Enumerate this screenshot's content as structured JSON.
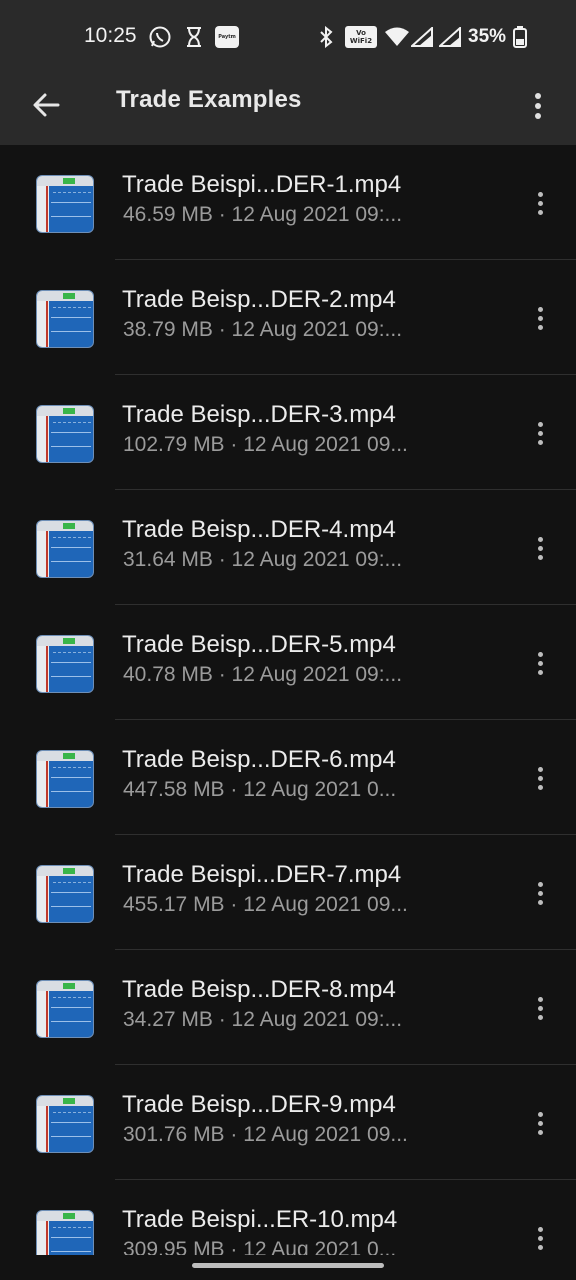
{
  "status_bar": {
    "time": "10:25",
    "icons_left": [
      "whatsapp-icon",
      "hourglass-icon",
      "paytm-icon"
    ],
    "icons_right": [
      "bluetooth-icon",
      "vowifi-icon",
      "wifi-icon",
      "signal-icon",
      "signal-icon",
      "battery-icon"
    ],
    "paytm_label": "Paytm",
    "vowifi_label": "Vo WiFi2",
    "battery": "35%"
  },
  "app_bar": {
    "title": "Trade Examples"
  },
  "files": [
    {
      "name": "Trade Beispi...DER-1.mp4",
      "meta": "46.59 MB · 12 Aug 2021 09:..."
    },
    {
      "name": "Trade Beisp...DER-2.mp4",
      "meta": "38.79 MB · 12 Aug 2021 09:..."
    },
    {
      "name": "Trade Beisp...DER-3.mp4",
      "meta": "102.79 MB · 12 Aug 2021 09..."
    },
    {
      "name": "Trade Beisp...DER-4.mp4",
      "meta": "31.64 MB · 12 Aug 2021 09:..."
    },
    {
      "name": "Trade Beisp...DER-5.mp4",
      "meta": "40.78 MB · 12 Aug 2021 09:..."
    },
    {
      "name": "Trade Beisp...DER-6.mp4",
      "meta": "447.58 MB · 12 Aug 2021 0..."
    },
    {
      "name": "Trade Beispi...DER-7.mp4",
      "meta": "455.17 MB · 12 Aug 2021 09..."
    },
    {
      "name": "Trade Beisp...DER-8.mp4",
      "meta": "34.27 MB · 12 Aug 2021 09:..."
    },
    {
      "name": "Trade Beisp...DER-9.mp4",
      "meta": "301.76 MB · 12 Aug 2021 09..."
    },
    {
      "name": "Trade Beispi...ER-10.mp4",
      "meta": "309.95 MB · 12 Aug 2021 0..."
    }
  ],
  "colors": {
    "background": "#121212",
    "app_bar": "#2a2a2a",
    "primary_text": "#ececec",
    "secondary_text": "#9b9b9b",
    "thumbnail_blue": "#1f66b8"
  }
}
